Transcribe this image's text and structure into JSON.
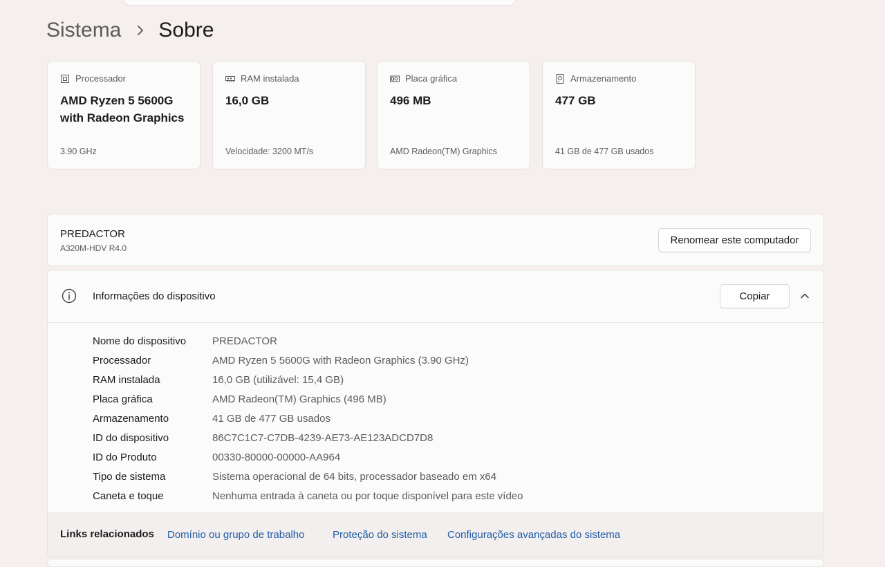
{
  "breadcrumb": {
    "parent": "Sistema",
    "current": "Sobre"
  },
  "cards": [
    {
      "icon": "processor-icon",
      "label": "Processador",
      "value": "AMD Ryzen 5 5600G with Radeon Graphics",
      "sub": "3.90 GHz"
    },
    {
      "icon": "ram-icon",
      "label": "RAM instalada",
      "value": "16,0 GB",
      "sub": "Velocidade: 3200 MT/s"
    },
    {
      "icon": "gpu-icon",
      "label": "Placa gráfica",
      "value": "496 MB",
      "sub": "AMD Radeon(TM) Graphics"
    },
    {
      "icon": "storage-icon",
      "label": "Armazenamento",
      "value": "477 GB",
      "sub": "41 GB de 477 GB usados"
    }
  ],
  "computer": {
    "name": "PREDACTOR",
    "model": "A320M-HDV R4.0",
    "rename_label": "Renomear este computador"
  },
  "device_info": {
    "title": "Informações do dispositivo",
    "copy_label": "Copiar",
    "specs": [
      {
        "label": "Nome do dispositivo",
        "value": "PREDACTOR"
      },
      {
        "label": "Processador",
        "value": "AMD Ryzen 5 5600G with Radeon Graphics (3.90 GHz)"
      },
      {
        "label": "RAM instalada",
        "value": "16,0 GB (utilizável: 15,4 GB)"
      },
      {
        "label": "Placa gráfica",
        "value": "AMD Radeon(TM) Graphics (496 MB)"
      },
      {
        "label": "Armazenamento",
        "value": "41 GB de 477 GB usados"
      },
      {
        "label": "ID do dispositivo",
        "value": "86C7C1C7-C7DB-4239-AE73-AE123ADCD7D8"
      },
      {
        "label": "ID do Produto",
        "value": "00330-80000-00000-AA964"
      },
      {
        "label": "Tipo de sistema",
        "value": "Sistema operacional de 64 bits, processador baseado em x64"
      },
      {
        "label": "Caneta e toque",
        "value": "Nenhuma entrada à caneta ou por toque disponível para este vídeo"
      }
    ]
  },
  "related_links": {
    "title": "Links relacionados",
    "items": [
      "Domínio ou grupo de trabalho",
      "Proteção do sistema",
      "Configurações avançadas do sistema"
    ]
  },
  "colors": {
    "background": "#f5efed",
    "panel": "#fbfbfb",
    "link": "#1f5da8"
  }
}
